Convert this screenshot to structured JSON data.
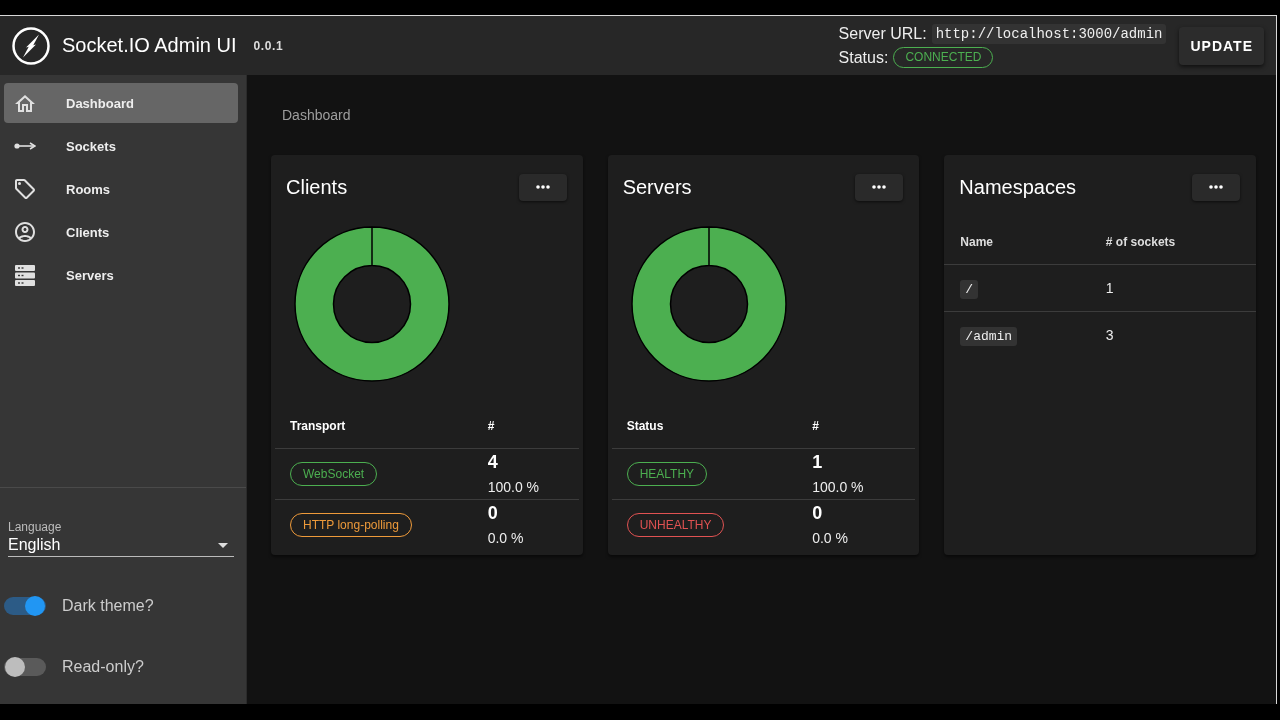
{
  "app": {
    "title": "Socket.IO Admin UI",
    "version": "0.0.1"
  },
  "server": {
    "url_label": "Server URL:",
    "url": "http://localhost:3000/admin",
    "status_label": "Status:",
    "status": {
      "label": "CONNECTED",
      "connected": true
    }
  },
  "update_button": "UPDATE",
  "nav": [
    {
      "label": "Dashboard",
      "selected": true
    },
    {
      "label": "Sockets",
      "selected": false
    },
    {
      "label": "Rooms",
      "selected": false
    },
    {
      "label": "Clients",
      "selected": false
    },
    {
      "label": "Servers",
      "selected": false
    }
  ],
  "language": {
    "label": "Language",
    "value": "English"
  },
  "settings": [
    {
      "label": "Dark theme?",
      "on": true
    },
    {
      "label": "Read-only?",
      "on": false
    }
  ],
  "breadcrumb": "Dashboard",
  "cards": [
    {
      "kind": "chart",
      "title": "Clients",
      "chart_data": {
        "type": "donut",
        "values": [
          100,
          0
        ]
      },
      "table": {
        "columns": [
          "Transport",
          "#"
        ],
        "rows": [
          {
            "label": "WebSocket",
            "color": "#4caf50",
            "count": "4",
            "share": "100.0 %"
          },
          {
            "label": "HTTP long-polling",
            "color": "#ee9a3a",
            "count": "0",
            "share": "0.0 %"
          }
        ]
      }
    },
    {
      "kind": "chart",
      "title": "Servers",
      "chart_data": {
        "type": "donut",
        "values": [
          100,
          0
        ]
      },
      "table": {
        "columns": [
          "Status",
          "#"
        ],
        "rows": [
          {
            "label": "HEALTHY",
            "color": "#4caf50",
            "count": "1",
            "share": "100.0 %"
          },
          {
            "label": "UNHEALTHY",
            "color": "#e05252",
            "count": "0",
            "share": "0.0 %"
          }
        ]
      }
    },
    {
      "kind": "list",
      "title": "Namespaces",
      "table": {
        "columns": [
          "Name",
          "# of sockets"
        ],
        "rows": [
          {
            "name": "/",
            "sockets": "1"
          },
          {
            "name": "/admin",
            "sockets": "3"
          }
        ]
      }
    }
  ]
}
